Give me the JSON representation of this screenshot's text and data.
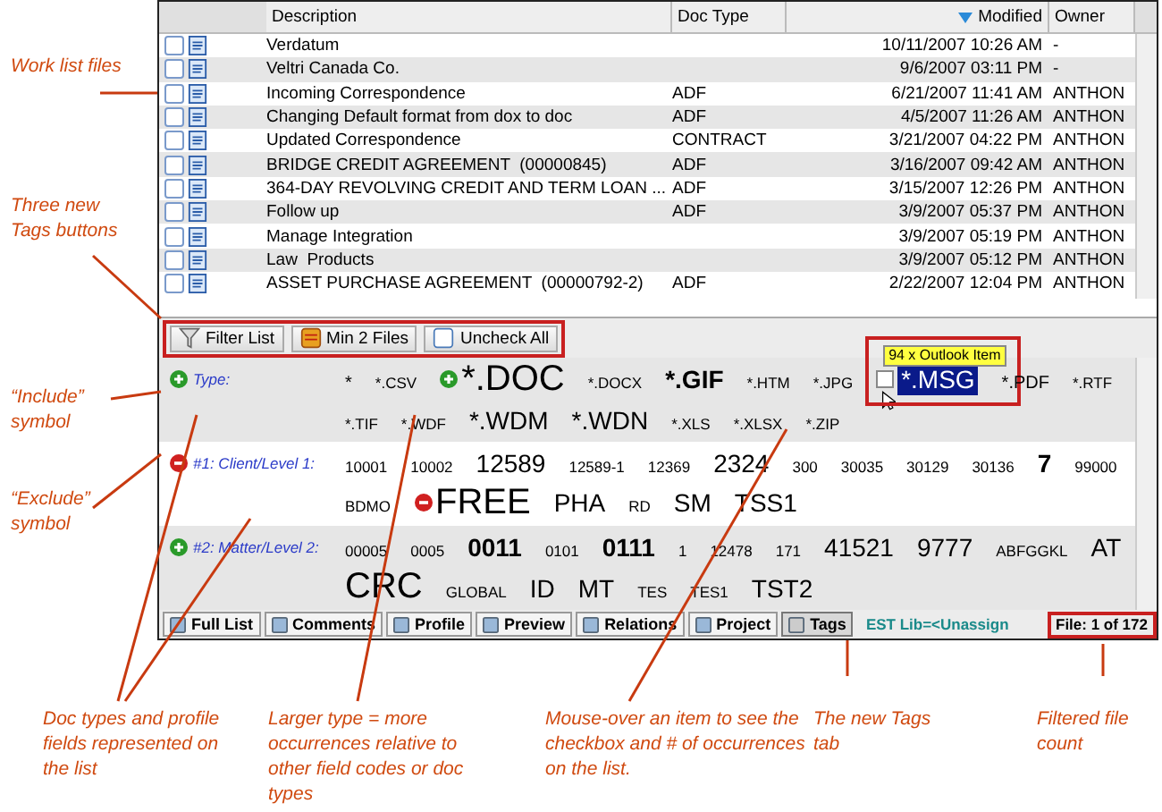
{
  "worklist": {
    "columns": [
      {
        "label": "Description",
        "sorted": false
      },
      {
        "label": "Doc Type",
        "sorted": false
      },
      {
        "label": "Modified",
        "sorted": true
      },
      {
        "label": "Owner",
        "sorted": false
      }
    ],
    "rows": [
      {
        "checked": false,
        "description": "Verdatum",
        "doc_type": "",
        "modified": "10/11/2007 10:26 AM",
        "owner": "-"
      },
      {
        "checked": false,
        "description": "Veltri Canada Co.",
        "doc_type": "",
        "modified": "9/6/2007 03:11 PM",
        "owner": "-"
      },
      {
        "checked": false,
        "description": "Incoming Correspondence",
        "doc_type": "ADF",
        "modified": "6/21/2007 11:41 AM",
        "owner": "ANTHON"
      },
      {
        "checked": false,
        "description": "Changing Default format from dox to doc",
        "doc_type": "ADF",
        "modified": "4/5/2007 11:26 AM",
        "owner": "ANTHON"
      },
      {
        "checked": false,
        "description": "Updated Correspondence",
        "doc_type": "CONTRACT",
        "modified": "3/21/2007 04:22 PM",
        "owner": "ANTHON"
      },
      {
        "checked": false,
        "description": "BRIDGE CREDIT AGREEMENT  (00000845)",
        "doc_type": "ADF",
        "modified": "3/16/2007 09:42 AM",
        "owner": "ANTHON"
      },
      {
        "checked": false,
        "description": "364-DAY REVOLVING CREDIT AND TERM LOAN ...",
        "doc_type": "ADF",
        "modified": "3/15/2007 12:26 PM",
        "owner": "ANTHON"
      },
      {
        "checked": false,
        "description": "Follow up",
        "doc_type": "ADF",
        "modified": "3/9/2007 05:37 PM",
        "owner": "ANTHON"
      },
      {
        "checked": false,
        "description": "Manage Integration",
        "doc_type": "",
        "modified": "3/9/2007 05:19 PM",
        "owner": "ANTHON"
      },
      {
        "checked": false,
        "description": "Law  Products",
        "doc_type": "",
        "modified": "3/9/2007 05:12 PM",
        "owner": "ANTHON"
      },
      {
        "checked": false,
        "description": "ASSET PURCHASE AGREEMENT  (00000792-2)",
        "doc_type": "ADF",
        "modified": "2/22/2007 12:04 PM",
        "owner": "ANTHON"
      }
    ]
  },
  "toolbar": [
    {
      "kind": "filter",
      "label": "Filter List"
    },
    {
      "kind": "min",
      "label": "Min 2 Files"
    },
    {
      "kind": "uncheck",
      "label": "Uncheck All"
    }
  ],
  "tag_groups": [
    {
      "label": "Type:",
      "excluded": false,
      "tags": [
        {
          "text": "*",
          "kind": "normal"
        },
        {
          "text": "*.CSV",
          "kind": "small"
        },
        {
          "text": "*.DOC",
          "kind": "largest",
          "excluded": false
        },
        {
          "text": "*.DOCX",
          "kind": "small"
        },
        {
          "text": "*.GIF",
          "kind": "large"
        },
        {
          "text": "*.HTM",
          "kind": "small"
        },
        {
          "text": "*.JPG",
          "kind": "small"
        },
        {
          "text": "*.MSG",
          "kind": "medium",
          "hovered": true,
          "checked": false,
          "tooltip": "94 x Outlook Item"
        },
        {
          "text": "*.PDF",
          "kind": "normal"
        },
        {
          "text": "*.RTF",
          "kind": "small"
        },
        {
          "text": "*.TIF",
          "kind": "small"
        },
        {
          "text": "*.WDF",
          "kind": "small"
        },
        {
          "text": "*.WDM",
          "kind": "medium"
        },
        {
          "text": "*.WDN",
          "kind": "medium"
        },
        {
          "text": "*.XLS",
          "kind": "small"
        },
        {
          "text": "*.XLSX",
          "kind": "small"
        },
        {
          "text": "*.ZIP",
          "kind": "small"
        }
      ]
    },
    {
      "label": "#1: Client/Level 1:",
      "excluded": true,
      "tags": [
        {
          "text": "10001",
          "kind": "small"
        },
        {
          "text": "10002",
          "kind": "small"
        },
        {
          "text": "12589",
          "kind": "medium"
        },
        {
          "text": "12589-1",
          "kind": "small"
        },
        {
          "text": "12369",
          "kind": "small"
        },
        {
          "text": "2324",
          "kind": "medium"
        },
        {
          "text": "300",
          "kind": "small"
        },
        {
          "text": "30035",
          "kind": "small"
        },
        {
          "text": "30129",
          "kind": "small"
        },
        {
          "text": "30136",
          "kind": "small"
        },
        {
          "text": "7",
          "kind": "large"
        },
        {
          "text": "99000",
          "kind": "small"
        },
        {
          "text": "BDMO",
          "kind": "small"
        },
        {
          "text": "FREE",
          "kind": "largest",
          "excluded": true
        },
        {
          "text": "PHA",
          "kind": "medium"
        },
        {
          "text": "RD",
          "kind": "small"
        },
        {
          "text": "SM",
          "kind": "medium"
        },
        {
          "text": "TSS1",
          "kind": "medium"
        }
      ]
    },
    {
      "label": "#2: Matter/Level 2:",
      "excluded": false,
      "tags": [
        {
          "text": "00005",
          "kind": "small"
        },
        {
          "text": "0005",
          "kind": "small"
        },
        {
          "text": "0011",
          "kind": "large"
        },
        {
          "text": "0101",
          "kind": "small"
        },
        {
          "text": "0111",
          "kind": "large"
        },
        {
          "text": "1",
          "kind": "small"
        },
        {
          "text": "12478",
          "kind": "small"
        },
        {
          "text": "171",
          "kind": "small"
        },
        {
          "text": "41521",
          "kind": "medium"
        },
        {
          "text": "9777",
          "kind": "medium"
        },
        {
          "text": "ABFGGKL",
          "kind": "small"
        },
        {
          "text": "AT",
          "kind": "medium"
        },
        {
          "text": "CRC",
          "kind": "largest"
        },
        {
          "text": "GLOBAL",
          "kind": "small"
        },
        {
          "text": "ID",
          "kind": "medium"
        },
        {
          "text": "MT",
          "kind": "medium"
        },
        {
          "text": "TES",
          "kind": "small"
        },
        {
          "text": "TES1",
          "kind": "small"
        },
        {
          "text": "TST2",
          "kind": "medium"
        }
      ]
    }
  ],
  "tabs": [
    {
      "label": "Full List",
      "selected": false
    },
    {
      "label": "Comments",
      "selected": false
    },
    {
      "label": "Profile",
      "selected": false
    },
    {
      "label": "Preview",
      "selected": false
    },
    {
      "label": "Relations",
      "selected": false
    },
    {
      "label": "Project",
      "selected": false
    },
    {
      "label": "Tags",
      "selected": true
    }
  ],
  "status": {
    "library": "EST Lib=<Unassign",
    "file_count": "File: 1 of 172"
  },
  "annotations": [
    {
      "kind": "left",
      "text": "Work list files"
    },
    {
      "kind": "left",
      "text": "Three new Tags buttons"
    },
    {
      "kind": "left",
      "text": "“Include” symbol"
    },
    {
      "kind": "left",
      "text": "“Exclude” symbol"
    },
    {
      "kind": "bottom",
      "text": "Doc types and profile fields represented on the list"
    },
    {
      "kind": "bottom",
      "text": "Larger type = more occurrences relative to other field codes or doc types"
    },
    {
      "kind": "bottom",
      "text": "Mouse-over an item to see the checkbox and # of occurrences on the list."
    },
    {
      "kind": "bottom",
      "text": "The new Tags tab"
    },
    {
      "kind": "bottom",
      "text": "Filtered file count"
    }
  ]
}
